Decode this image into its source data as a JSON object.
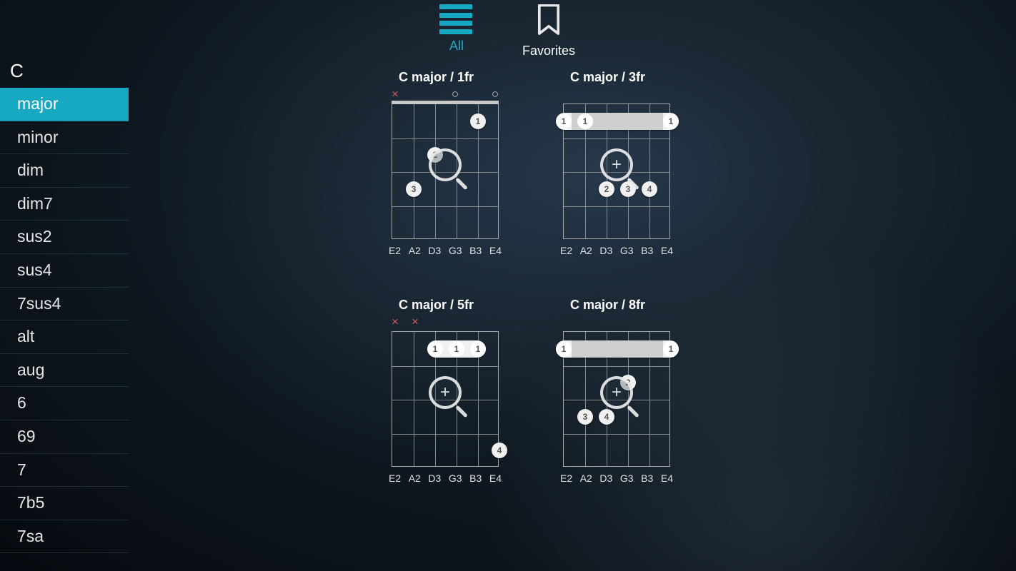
{
  "tabs": {
    "all": "All",
    "favorites": "Favorites",
    "active": "all"
  },
  "sidebar": {
    "root": "C",
    "types": [
      "major",
      "minor",
      "dim",
      "dim7",
      "sus2",
      "sus4",
      "7sus4",
      "alt",
      "aug",
      "6",
      "69",
      "7",
      "7b5",
      "7sa"
    ],
    "selected_index": 0
  },
  "strings": [
    "E2",
    "A2",
    "D3",
    "G3",
    "B3",
    "E4"
  ],
  "chords": [
    {
      "title": "C major / 1fr",
      "nut": true,
      "openMarks": [
        "x",
        "",
        "",
        "o",
        "",
        "o"
      ],
      "barre": null,
      "dots": [
        {
          "string": 4,
          "fret": 1,
          "finger": "1"
        },
        {
          "string": 2,
          "fret": 2,
          "finger": "2"
        },
        {
          "string": 1,
          "fret": 3,
          "finger": "3"
        }
      ],
      "zoom_plus": false
    },
    {
      "title": "C major / 3fr",
      "nut": false,
      "openMarks": [
        "",
        "",
        "",
        "",
        "",
        ""
      ],
      "barre": {
        "fret": 1,
        "from": 0,
        "to": 5,
        "fingers": [
          {
            "string": 0,
            "n": "1"
          },
          {
            "string": 1,
            "n": "1"
          },
          {
            "string": 5,
            "n": "1"
          }
        ],
        "ghost": true
      },
      "dots": [
        {
          "string": 2,
          "fret": 3,
          "finger": "2"
        },
        {
          "string": 3,
          "fret": 3,
          "finger": "3"
        },
        {
          "string": 4,
          "fret": 3,
          "finger": "4"
        }
      ],
      "zoom_plus": true
    },
    {
      "title": "C major / 5fr",
      "nut": false,
      "openMarks": [
        "x",
        "x",
        "",
        "",
        "",
        ""
      ],
      "barre": {
        "fret": 1,
        "from": 2,
        "to": 4,
        "fingers": [
          {
            "string": 2,
            "n": "1"
          },
          {
            "string": 3,
            "n": "1"
          },
          {
            "string": 4,
            "n": "1"
          }
        ],
        "ghost": false
      },
      "dots": [
        {
          "string": 5,
          "fret": 4,
          "finger": "4"
        }
      ],
      "zoom_plus": true
    },
    {
      "title": "C major / 8fr",
      "nut": false,
      "openMarks": [
        "",
        "",
        "",
        "",
        "",
        ""
      ],
      "barre": {
        "fret": 1,
        "from": 0,
        "to": 5,
        "fingers": [
          {
            "string": 0,
            "n": "1"
          },
          {
            "string": 5,
            "n": "1"
          }
        ],
        "ghost": true
      },
      "dots": [
        {
          "string": 3,
          "fret": 2,
          "finger": "2"
        },
        {
          "string": 1,
          "fret": 3,
          "finger": "3"
        },
        {
          "string": 2,
          "fret": 3,
          "finger": "4"
        }
      ],
      "zoom_plus": true
    }
  ]
}
